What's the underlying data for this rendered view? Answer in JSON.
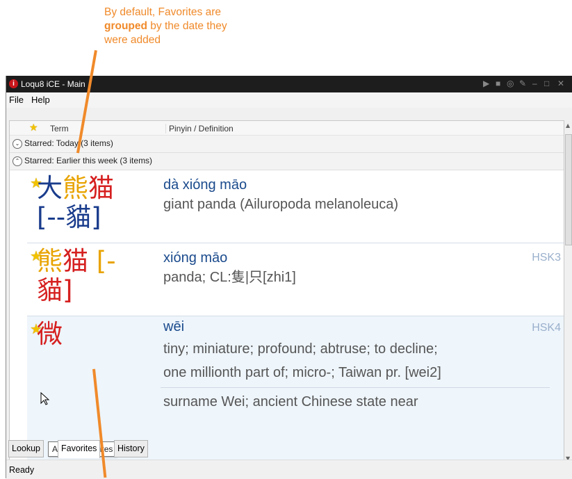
{
  "annotation": {
    "line1": "By default, Favorites are",
    "bold": "grouped",
    "line2_rest": " by the date they",
    "line3": "were added"
  },
  "window": {
    "title": "Loqu8 iCE - Main",
    "controls": [
      "▶",
      "■",
      "◎",
      "✎",
      "–",
      "□",
      "✕"
    ]
  },
  "menu": {
    "items": [
      "File",
      "Help"
    ]
  },
  "columns": {
    "term": "Term",
    "pinyin": "Pinyin / Definition"
  },
  "groups": [
    {
      "label": "Starred: Today (3 items)",
      "chevron": "⌄"
    },
    {
      "label": "Starred: Earlier this week (3 items)",
      "chevron": "⌃"
    }
  ],
  "entries": [
    {
      "hanzi_chars": [
        {
          "c": "大",
          "color": "#1a3c8c"
        },
        {
          "c": "熊",
          "color": "#e8a300"
        },
        {
          "c": "猫",
          "color": "#d62020"
        }
      ],
      "hanzi_line2": "[--貓]",
      "pinyin": "dà xióng māo",
      "definition": "giant panda (Ailuropoda melanoleuca)",
      "hsk": ""
    },
    {
      "hanzi_chars": [
        {
          "c": "熊",
          "color": "#e8a300"
        },
        {
          "c": "猫",
          "color": "#d62020"
        }
      ],
      "hanzi_line1_suffix": " [-",
      "hanzi_line2": "貓]",
      "pinyin": "xióng māo",
      "definition": "panda; CL:隻|只[zhi1]",
      "hsk": "HSK3"
    },
    {
      "hanzi_chars": [
        {
          "c": "微",
          "color": "#d62020"
        }
      ],
      "pinyin": "wēi",
      "definition_lines": [
        "tiny; miniature; profound; abtruse; to decline;",
        "one millionth part of; micro-; Taiwan pr. [wei2]",
        "surname Wei; ancient Chinese state near"
      ],
      "hsk": "HSK4"
    }
  ],
  "tooltip": "Add to Favorites",
  "tabs": [
    "Lookup",
    "Favorites",
    "History"
  ],
  "active_tab": "Favorites",
  "status": "Ready",
  "colors": {
    "accent": "#f08a2a",
    "star": "#f2c200",
    "pinyin": "#1a4a8c",
    "selected_row": "#eef5fb"
  }
}
